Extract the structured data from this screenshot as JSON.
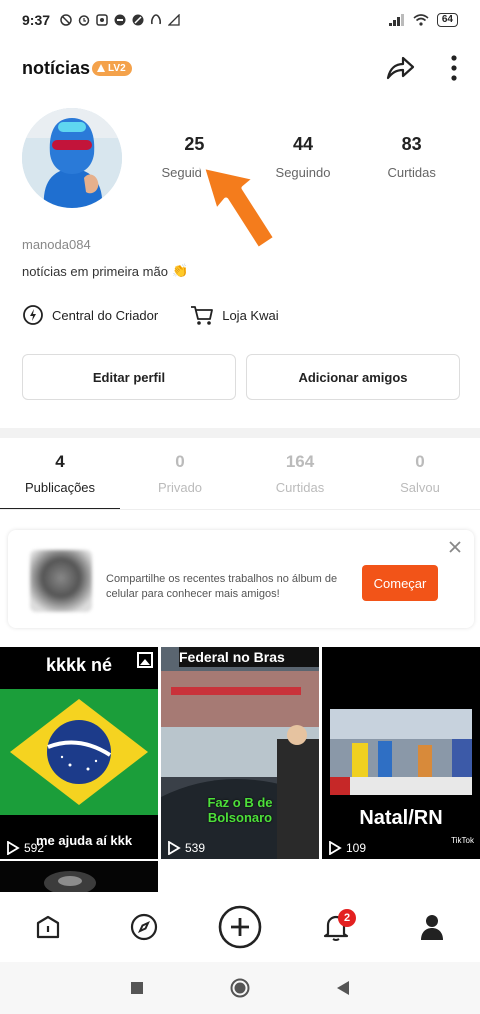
{
  "status_bar": {
    "time": "9:37",
    "battery": "64"
  },
  "header": {
    "title": "notícias",
    "level_badge": "LV2"
  },
  "profile": {
    "stats": [
      {
        "value": "25",
        "label": "Seguidores"
      },
      {
        "value": "44",
        "label": "Seguindo"
      },
      {
        "value": "83",
        "label": "Curtidas"
      }
    ],
    "username": "manoda084",
    "bio": "notícias em primeira mão",
    "bio_emoji": "👏",
    "links": [
      {
        "label": "Central do Criador",
        "icon": "creator-center-icon"
      },
      {
        "label": "Loja Kwai",
        "icon": "shopping-cart-icon"
      }
    ],
    "buttons": {
      "edit": "Editar perfil",
      "add_friends": "Adicionar amigos"
    }
  },
  "tabs": [
    {
      "count": "4",
      "label": "Publicações",
      "active": true
    },
    {
      "count": "0",
      "label": "Privado"
    },
    {
      "count": "164",
      "label": "Curtidas"
    },
    {
      "count": "0",
      "label": "Salvou"
    }
  ],
  "promo": {
    "text": "Compartilhe os recentes trabalhos no álbum de celular para conhecer mais amigos!",
    "button": "Começar"
  },
  "posts": [
    {
      "title": "kkkk né",
      "caption": "me ajuda aí kkk",
      "views": "592"
    },
    {
      "title": "Federal no Bras",
      "overlay": "Faz o B de Bolsonaro",
      "views": "539"
    },
    {
      "overlay": "Natal/RN",
      "views": "109",
      "watermark": "TikTok"
    }
  ],
  "bottom_nav": {
    "notifications_count": "2"
  },
  "colors": {
    "accent": "#f25418",
    "badge": "#e32020",
    "level": "#f4a24b"
  }
}
